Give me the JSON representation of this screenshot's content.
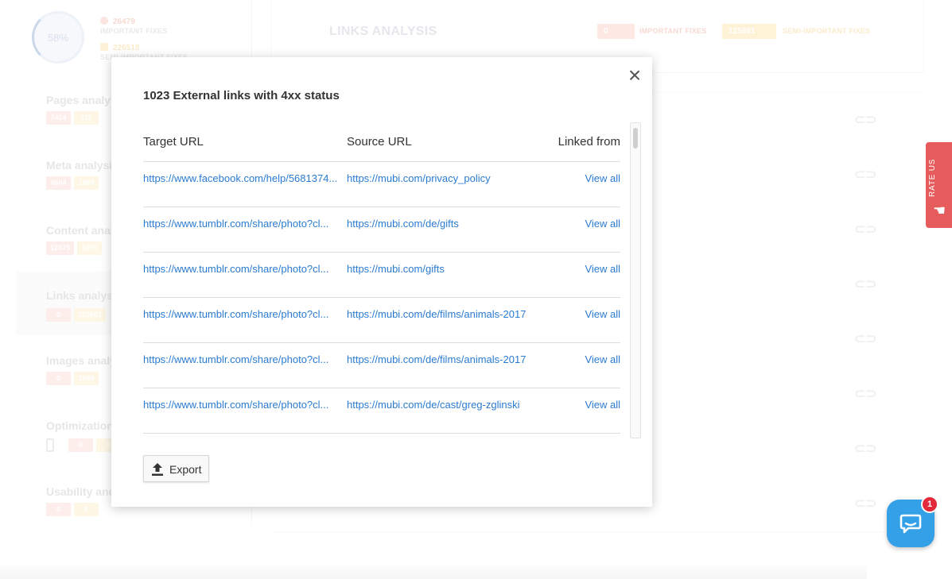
{
  "background": {
    "score": "58%",
    "important_count": "26479",
    "important_label": "IMPORTANT FIXES",
    "semi_count": "226518",
    "semi_label": "SEMI-IMPORTANT FIXES",
    "sidebar": [
      {
        "title": "Pages analysis",
        "b1": "7414",
        "b2": "111"
      },
      {
        "title": "Meta analysis",
        "b1": "4604",
        "b2": "1069"
      },
      {
        "title": "Content analysis",
        "b1": "12075",
        "b2": "1050"
      },
      {
        "title": "Links analysis",
        "b1": "0",
        "b2": "125691"
      },
      {
        "title": "Images analysis",
        "b1": "0",
        "b2": "1049"
      },
      {
        "title": "Optimization",
        "b1": "0",
        "b2": "0"
      },
      {
        "title": "Usability and",
        "b1": "0",
        "b2": "0"
      }
    ],
    "main_title": "LINKS ANALYSIS",
    "pill_important": "0",
    "pill_important_label": "IMPORTANT FIXES",
    "pill_semi": "125691",
    "pill_semi_label": "SEMI-IMPORTANT FIXES"
  },
  "modal": {
    "title": "1023 External links with 4xx status",
    "columns": {
      "target": "Target URL",
      "source": "Source URL",
      "linked": "Linked from"
    },
    "rows": [
      {
        "target": "https://www.facebook.com/help/5681374...",
        "source": "https://mubi.com/privacy_policy",
        "linked": "View all"
      },
      {
        "target": "https://www.tumblr.com/share/photo?cl...",
        "source": "https://mubi.com/de/gifts",
        "linked": "View all"
      },
      {
        "target": "https://www.tumblr.com/share/photo?cl...",
        "source": "https://mubi.com/gifts",
        "linked": "View all"
      },
      {
        "target": "https://www.tumblr.com/share/photo?cl...",
        "source": "https://mubi.com/de/films/animals-2017",
        "linked": "View all"
      },
      {
        "target": "https://www.tumblr.com/share/photo?cl...",
        "source": "https://mubi.com/de/films/animals-2017",
        "linked": "View all"
      },
      {
        "target": "https://www.tumblr.com/share/photo?cl...",
        "source": "https://mubi.com/de/cast/greg-zglinski",
        "linked": "View all"
      }
    ],
    "export_label": "Export",
    "close_symbol": "×"
  },
  "rate_us": "RATE US",
  "chat_badge": "1",
  "colors": {
    "link": "#2a7bd1",
    "rate_us": "#e65c5c",
    "chat": "#33a0e8",
    "badge": "#e4283c"
  }
}
